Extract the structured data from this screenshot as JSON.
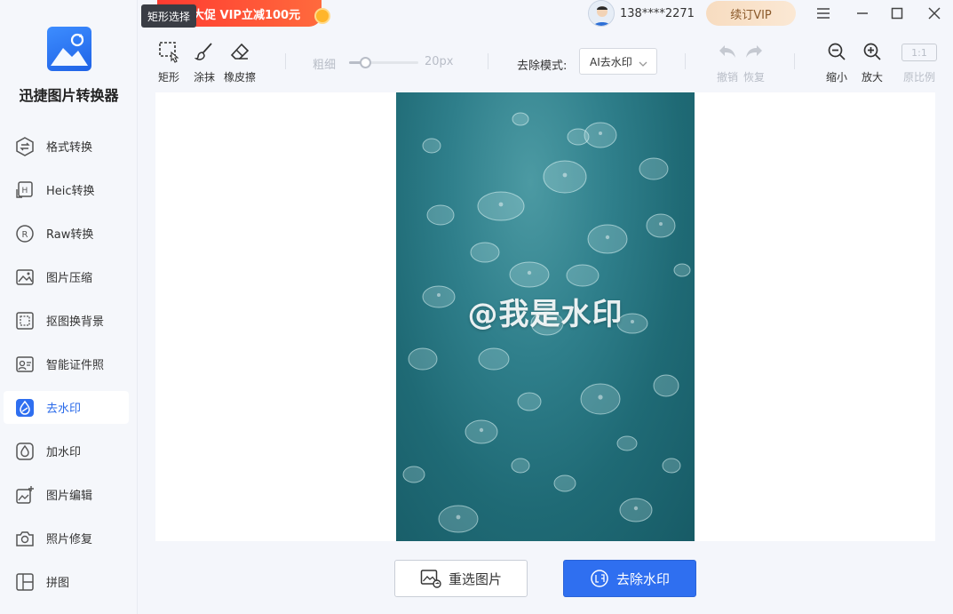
{
  "app": {
    "name": "迅捷图片转换器"
  },
  "promo": {
    "text": "大促 VIP立减100元"
  },
  "tooltip": {
    "text": "矩形选择"
  },
  "user": {
    "phone": "138****2271",
    "vip_label": "续订VIP"
  },
  "sidebar": {
    "items": [
      {
        "label": "格式转换",
        "icon": "format-convert-icon",
        "active": false
      },
      {
        "label": "Heic转换",
        "icon": "heic-icon",
        "active": false
      },
      {
        "label": "Raw转换",
        "icon": "raw-icon",
        "active": false
      },
      {
        "label": "图片压缩",
        "icon": "image-compress-icon",
        "active": false
      },
      {
        "label": "抠图换背景",
        "icon": "cutout-icon",
        "active": false
      },
      {
        "label": "智能证件照",
        "icon": "id-photo-icon",
        "active": false
      },
      {
        "label": "去水印",
        "icon": "remove-watermark-icon",
        "active": true
      },
      {
        "label": "加水印",
        "icon": "add-watermark-icon",
        "active": false
      },
      {
        "label": "图片编辑",
        "icon": "image-edit-icon",
        "active": false
      },
      {
        "label": "照片修复",
        "icon": "photo-repair-icon",
        "active": false
      },
      {
        "label": "拼图",
        "icon": "collage-icon",
        "active": false
      }
    ]
  },
  "toolbar": {
    "rect_label": "矩形",
    "brush_label": "涂抹",
    "eraser_label": "橡皮擦",
    "size_label": "粗细",
    "size_value": "20px",
    "size_fraction": 0.2,
    "mode_label": "去除模式:",
    "mode_value": "AI去水印",
    "undo_label": "撤销",
    "redo_label": "恢复",
    "zoom_out_label": "缩小",
    "zoom_in_label": "放大",
    "ratio_box": "1:1",
    "ratio_label": "原比例"
  },
  "canvas": {
    "watermark_text": "@我是水印"
  },
  "actions": {
    "reselect_label": "重选图片",
    "remove_label": "去除水印"
  },
  "colors": {
    "accent": "#2f6ff0",
    "promo": "#ff3b30",
    "vip": "#f7dcc0",
    "sea": "#2f7f8b"
  }
}
